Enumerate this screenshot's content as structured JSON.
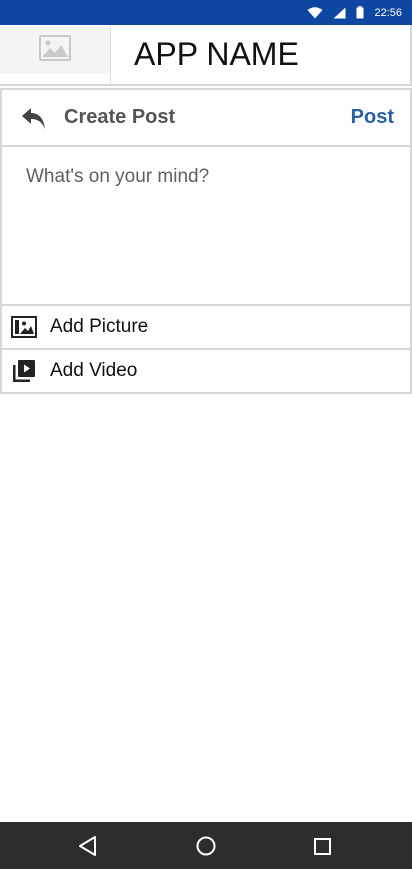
{
  "status_bar": {
    "time": "22:56",
    "icons": [
      "wifi-icon",
      "signal-icon",
      "battery-icon"
    ],
    "color": "#0d47a1"
  },
  "header": {
    "app_name": "APP NAME",
    "logo_icon": "image-placeholder-icon"
  },
  "post_bar": {
    "back_icon": "reply-arrow-icon",
    "title": "Create Post",
    "action_label": "Post",
    "action_color": "#2b5fa6"
  },
  "compose": {
    "placeholder": "What's on your mind?",
    "value": ""
  },
  "options": {
    "picture": {
      "label": "Add Picture",
      "icon": "picture-icon"
    },
    "video": {
      "label": "Add Video",
      "icon": "video-library-icon"
    }
  },
  "nav_bar": {
    "buttons": [
      "back-triangle-icon",
      "home-circle-icon",
      "recent-square-icon"
    ]
  }
}
